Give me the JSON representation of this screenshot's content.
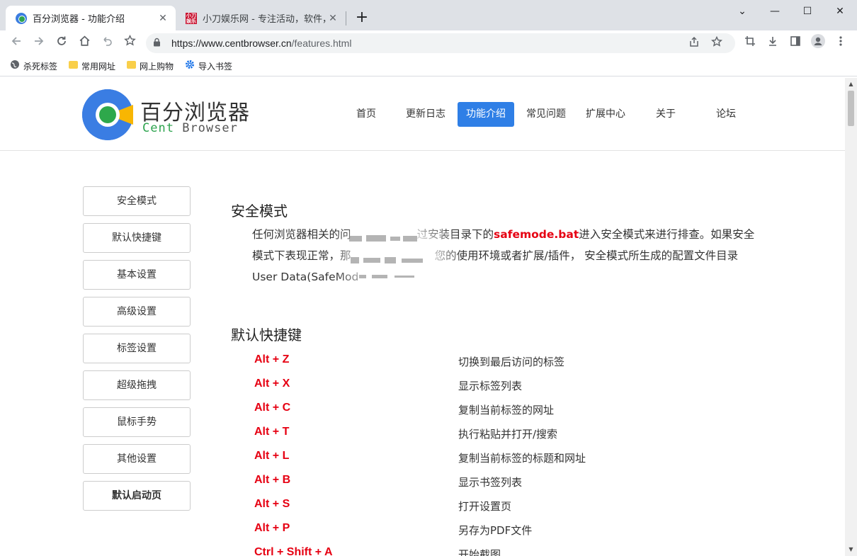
{
  "browser": {
    "tabs": [
      {
        "title": "百分浏览器 - 功能介绍",
        "close": "✕"
      },
      {
        "title": "小刀娱乐网 - 专注活动，软件，教",
        "close": "✕"
      }
    ],
    "new_tab": "+",
    "window_controls": [
      "⌄",
      "—",
      "☐",
      "✕"
    ],
    "url_host": "https://www.centbrowser.cn",
    "url_path": "/features.html",
    "bookmarks": [
      "杀死标签",
      "常用网址",
      "网上购物",
      "导入书签"
    ]
  },
  "site": {
    "brand_cn": "百分浏览器",
    "brand_en_1": "Cent",
    "brand_en_2": "Browser",
    "nav": [
      "首页",
      "更新日志",
      "功能介绍",
      "常见问题",
      "扩展中心",
      "关于",
      "论坛"
    ],
    "active_nav": "功能介绍"
  },
  "sidebar": [
    "安全模式",
    "默认快捷键",
    "基本设置",
    "高级设置",
    "标签设置",
    "超级拖拽",
    "鼠标手势",
    "其他设置",
    "默认启动页"
  ],
  "sections": {
    "safe_mode": {
      "title": "安全模式",
      "p1": "任何浏览器相关的问",
      "p1b": "过安装目录下的",
      "highlight": "safemode.bat",
      "p1c": "进入安全模式来进行排查。如果安全",
      "p2a": "模式下表现正常，那",
      "p2b": "您的使用环境或者扩展/插件， 安全模式所生成的配置文件目录",
      "p3": "User Data(SafeMod"
    },
    "shortcuts": {
      "title": "默认快捷键",
      "items": [
        {
          "key": "Alt + Z",
          "desc": "切换到最后访问的标签"
        },
        {
          "key": "Alt + X",
          "desc": "显示标签列表"
        },
        {
          "key": "Alt + C",
          "desc": "复制当前标签的网址"
        },
        {
          "key": "Alt + T",
          "desc": "执行粘贴并打开/搜索"
        },
        {
          "key": "Alt + L",
          "desc": "复制当前标签的标题和网址"
        },
        {
          "key": "Alt + B",
          "desc": "显示书签列表"
        },
        {
          "key": "Alt + S",
          "desc": "打开设置页"
        },
        {
          "key": "Alt + P",
          "desc": "另存为PDF文件"
        },
        {
          "key": "Ctrl + Shift + A",
          "desc": "开始截图"
        }
      ]
    }
  },
  "colors": {
    "accent": "#2f7fe6",
    "highlight": "#e60012"
  }
}
